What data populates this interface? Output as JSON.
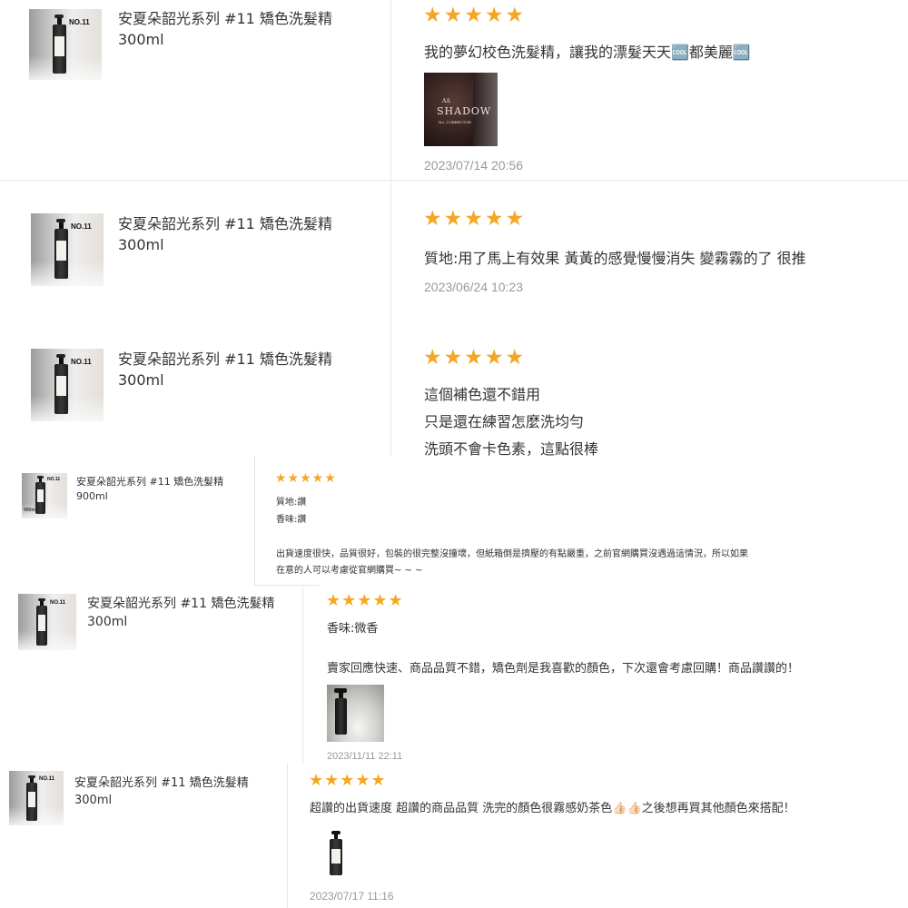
{
  "product": {
    "thumb_label": "NO.11",
    "thumb_label_large": "900ml"
  },
  "reviews": [
    {
      "product_name": "安夏朵韶光系列 #11 矯色洗髮精 300ml",
      "stars": "★★★★★",
      "text_lines": [
        "我的夢幻校色洗髮精，讓我的漂髮天天🆒都美麗🆒"
      ],
      "photo_label": [
        "AA",
        "SHADOW",
        "No. CORRECTOR"
      ],
      "timestamp": "2023/07/14 20:56"
    },
    {
      "product_name": "安夏朵韶光系列 #11 矯色洗髮精 300ml",
      "stars": "★★★★★",
      "text_lines": [
        "質地:用了馬上有效果 黃黃的感覺慢慢消失 變霧霧的了 很推"
      ],
      "timestamp": "2023/06/24 10:23"
    },
    {
      "product_name": "安夏朵韶光系列 #11 矯色洗髮精 300ml",
      "stars": "★★★★★",
      "text_lines": [
        "這個補色還不錯用",
        "只是還在練習怎麼洗均勻",
        "洗頭不會卡色素，這點很棒"
      ]
    },
    {
      "product_name": "安夏朵韶光系列 #11 矯色洗髮精 900ml",
      "stars": "★★★★★",
      "text_lines": [
        "質地:讚",
        "香味:讚",
        "",
        "出貨速度很快，品質很好，包裝的很完整沒撞壞，但紙箱倒是擠壓的有點嚴重，之前官網購買沒遇過這情況，所以如果",
        "在意的人可以考慮從官網購買~ ~ ~"
      ]
    },
    {
      "product_name": "安夏朵韶光系列 #11 矯色洗髮精 300ml",
      "stars": "★★★★★",
      "text_lines": [
        "香味:微香",
        "",
        "賣家回應快速、商品品質不錯，矯色劑是我喜歡的顏色，下次還會考慮回購！商品讚讚的！"
      ],
      "timestamp": "2023/11/11 22:11"
    },
    {
      "product_name": "安夏朵韶光系列 #11 矯色洗髮精 300ml",
      "stars": "★★★★★",
      "text_lines": [
        "超讚的出貨速度 超讚的商品品質 洗完的顏色很霧感奶茶色👍🏻👍🏻之後想再買其他顏色來搭配！"
      ],
      "timestamp": "2023/07/17 11:16"
    }
  ],
  "colors": {
    "star": "#f5a623",
    "text": "#333333",
    "timestamp": "#999999",
    "divider": "#e6e6e6"
  }
}
